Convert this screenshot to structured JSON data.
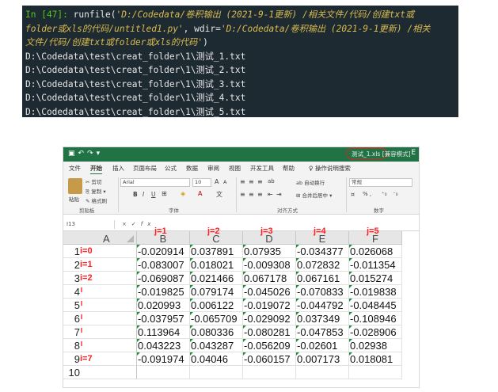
{
  "console": {
    "prompt": "In [47]:",
    "call_prefix": " runfile(",
    "arg1_line1": "'D:/Codedata/卷积输出 (2021-9-1更新) /相关文件/代码/创建txt或",
    "arg1_line2": "folder或xls的代码/untitled1.py'",
    "wdir_key": ", wdir=",
    "wdir_line2": "'D:/Codedata/卷积输出 (2021-9-1更新) /相关",
    "wdir_line3": "文件/代码/创建txt或folder或xls的代码'",
    "call_suffix": ")",
    "output_lines": [
      "D:\\Codedata\\test\\creat_folder\\1\\测试_1.txt",
      "D:\\Codedata\\test\\creat_folder\\1\\测试_2.txt",
      "D:\\Codedata\\test\\creat_folder\\1\\测试_3.txt",
      "D:\\Codedata\\test\\creat_folder\\1\\测试_4.txt",
      "D:\\Codedata\\test\\creat_folder\\1\\测试_5.txt"
    ]
  },
  "excel": {
    "doc_title": "测试_1.xls",
    "doc_mode": "[兼容模式]",
    "menu": [
      "文件",
      "开始",
      "插入",
      "页面布局",
      "公式",
      "数据",
      "审阅",
      "视图",
      "开发工具",
      "帮助",
      "♀ 操作说明搜索"
    ],
    "ribbon": {
      "cut": "✂ 剪切",
      "copy": "⎘ 复制 ▾",
      "painter": "✎ 格式刷",
      "paste": "粘贴",
      "font_name": "Arial",
      "font_size": "10",
      "grow": "A",
      "shrink": "A",
      "bold": "B",
      "italic": "I",
      "underline": "U",
      "wrap": "ab 自动换行",
      "merge": "⊞ 合并后居中 ▾",
      "number_format": "常规",
      "number_tools": "% ,",
      "groups": [
        "剪贴板",
        "字体",
        "对齐方式",
        "数字"
      ]
    },
    "name_box": "I13",
    "fx": "fx",
    "columns": [
      "A",
      "B",
      "C",
      "D",
      "E",
      "F"
    ],
    "j_labels": [
      "j=1",
      "j=2",
      "j=3",
      "j=4",
      "j=5"
    ],
    "rows": [
      {
        "num": "1",
        "label": "i=0",
        "values": [
          "-0.020914",
          "0.037891",
          "0.07935",
          "-0.034377",
          "0.026068"
        ]
      },
      {
        "num": "2",
        "label": "i=1",
        "values": [
          "-0.083007",
          "0.018021",
          "-0.009308",
          "0.072832",
          "-0.011354"
        ]
      },
      {
        "num": "3",
        "label": "i=2",
        "values": [
          "-0.069087",
          "0.021466",
          "0.067178",
          "0.067161",
          "0.015274"
        ]
      },
      {
        "num": "4",
        "label": "",
        "values": [
          "-0.019825",
          "0.079174",
          "-0.045026",
          "-0.070833",
          "-0.019838"
        ]
      },
      {
        "num": "5",
        "label": "",
        "values": [
          "0.020993",
          "0.006122",
          "-0.019072",
          "-0.044792",
          "-0.048445"
        ]
      },
      {
        "num": "6",
        "label": "",
        "values": [
          "-0.037957",
          "-0.065709",
          "-0.029092",
          "0.037349",
          "-0.108946"
        ]
      },
      {
        "num": "7",
        "label": "",
        "values": [
          "0.113964",
          "0.080336",
          "-0.080281",
          "-0.047853",
          "-0.028906"
        ]
      },
      {
        "num": "8",
        "label": "",
        "values": [
          "0.043223",
          "0.043287",
          "-0.056209",
          "-0.02601",
          "0.02938"
        ]
      },
      {
        "num": "9",
        "label": "i=7",
        "values": [
          "-0.091974",
          "0.04046",
          "-0.060157",
          "0.007173",
          "0.018081"
        ]
      },
      {
        "num": "10",
        "label": "",
        "values": [
          "",
          "",
          "",
          "",
          ""
        ]
      }
    ]
  }
}
